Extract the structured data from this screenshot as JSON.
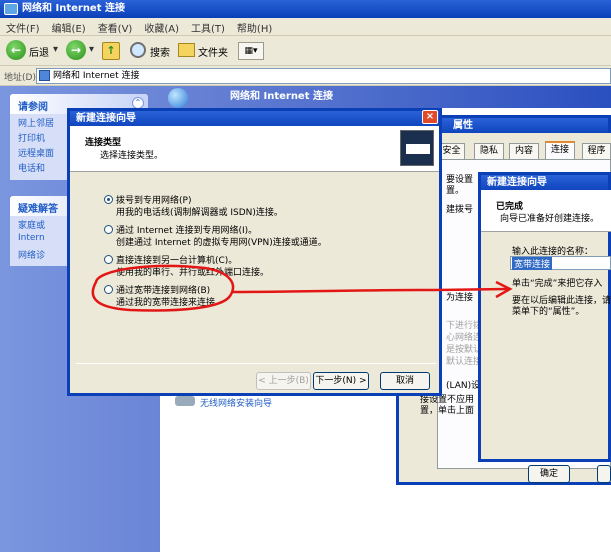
{
  "window": {
    "title": "网络和 Internet 连接"
  },
  "menu": [
    "文件(F)",
    "编辑(E)",
    "查看(V)",
    "收藏(A)",
    "工具(T)",
    "帮助(H)"
  ],
  "toolbar": {
    "back": "后退",
    "search": "搜索",
    "folders": "文件夹"
  },
  "address": {
    "label": "地址(D)",
    "value": "网络和 Internet 连接"
  },
  "sidebar": {
    "see_also": {
      "title": "请参阅",
      "items": [
        "网上邻居",
        "打印机",
        "远程桌面",
        "电话和"
      ]
    },
    "troubleshoot": {
      "title": "疑难解答",
      "items": [
        "家庭或",
        "Intern",
        "网络诊"
      ]
    }
  },
  "main": {
    "header": "网络和 Internet 连接",
    "bottom_link": "无线网络安装向导"
  },
  "wizard": {
    "title": "新建连接向导",
    "heading": "连接类型",
    "subheading": "选择连接类型。",
    "options": [
      {
        "title": "拨号到专用网络(P)",
        "desc": "用我的电话线(调制解调器或 ISDN)连接。",
        "selected": true
      },
      {
        "title": "通过 Internet 连接到专用网络(I)。",
        "desc": "创建通过 Internet 的虚拟专用网(VPN)连接或通道。",
        "selected": false
      },
      {
        "title": "直接连接到另一台计算机(C)。",
        "desc": "使用我的串行、并行或红外端口连接。",
        "selected": false
      },
      {
        "title": "通过宽带连接到网络(B)",
        "desc": "通过我的宽带连接来连接",
        "selected": false
      }
    ],
    "back": "< 上一步(B)",
    "next": "下一步(N) >",
    "cancel": "取消"
  },
  "props": {
    "title": "属性",
    "tabs": [
      "安全",
      "隐私",
      "内容",
      "连接",
      "程序"
    ],
    "fragments": [
      "要设置",
      "置。",
      "建拨号",
      "为连接",
      "下进行拨",
      "心网络连",
      "是按默认",
      "默认连接",
      "(LAN)设",
      "接设置不应用",
      "置，单击上面"
    ],
    "ok": "确定"
  },
  "wizard2": {
    "title": "新建连接向导",
    "heading": "已完成",
    "subheading": "向导已准备好创建连接。",
    "name_label": "输入此连接的名称：",
    "name_value": "宽带连接",
    "note1": "单击“完成”来把它存入",
    "note2": "要在以后编辑此连接，请",
    "note3": "菜单下的“属性”。"
  }
}
